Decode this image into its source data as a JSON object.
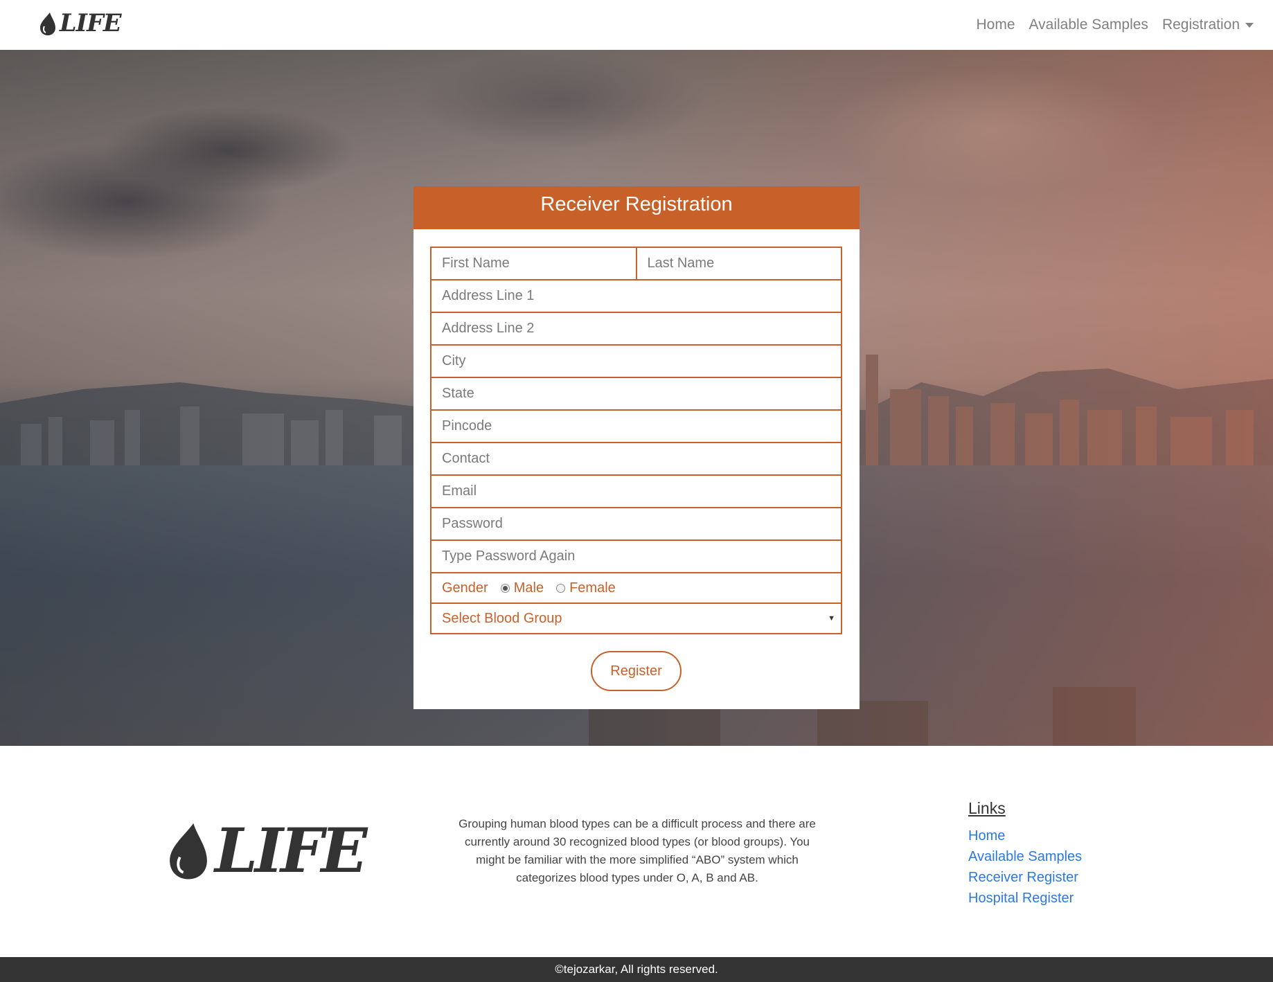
{
  "brand": {
    "name": "LIFE"
  },
  "nav": {
    "items": [
      {
        "label": "Home"
      },
      {
        "label": "Available Samples"
      },
      {
        "label": "Registration"
      }
    ]
  },
  "form": {
    "title": "Receiver Registration",
    "first_name_placeholder": "First Name",
    "last_name_placeholder": "Last Name",
    "address1_placeholder": "Address Line 1",
    "address2_placeholder": "Address Line 2",
    "city_placeholder": "City",
    "state_placeholder": "State",
    "pincode_placeholder": "Pincode",
    "contact_placeholder": "Contact",
    "email_placeholder": "Email",
    "password_placeholder": "Password",
    "password_again_placeholder": "Type Password Again",
    "gender_label": "Gender",
    "gender_options": [
      {
        "label": "Male",
        "selected": true
      },
      {
        "label": "Female",
        "selected": false
      }
    ],
    "blood_group_selected": "Select Blood Group",
    "submit_label": "Register"
  },
  "footer": {
    "logo_text": "LIFE",
    "description": "Grouping human blood types can be a difficult process and there are currently around 30 recognized blood types (or blood groups). You might be familiar with the more simplified “ABO” system which categorizes blood types under O, A, B and AB.",
    "links_title": "Links",
    "links": [
      {
        "label": "Home"
      },
      {
        "label": "Available Samples"
      },
      {
        "label": "Receiver Register"
      },
      {
        "label": "Hospital Register"
      }
    ],
    "copyright": "©tejozarkar, All rights reserved."
  },
  "colors": {
    "accent": "#c8602a",
    "link": "#2a7ae2",
    "footer_bar": "#333333"
  }
}
